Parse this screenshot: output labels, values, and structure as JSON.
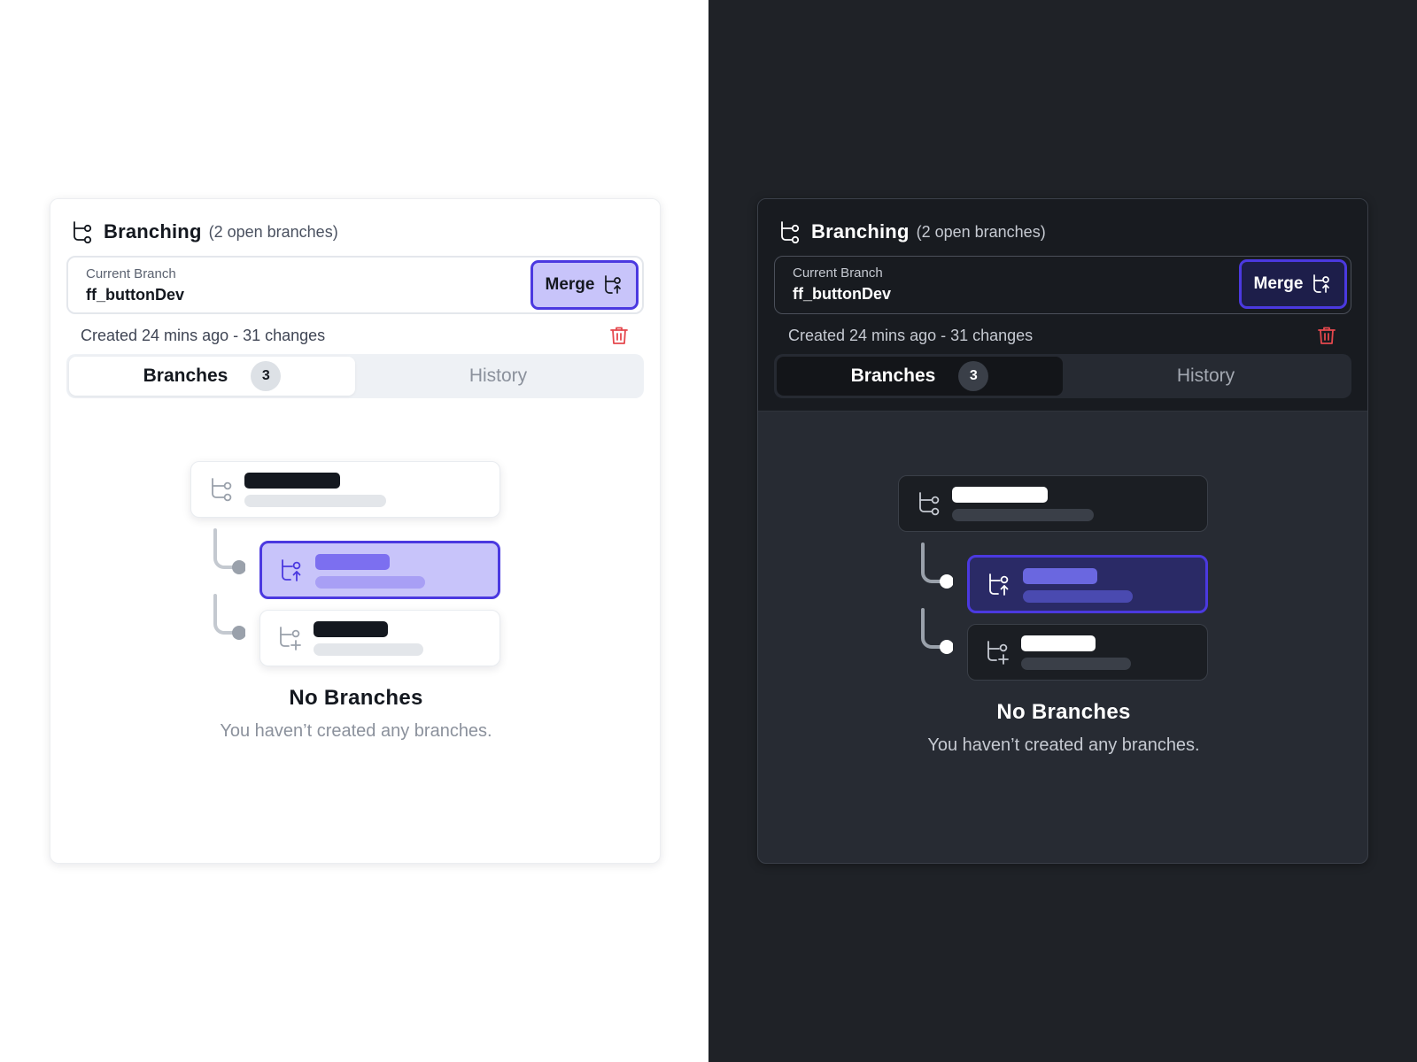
{
  "panels": [
    {
      "theme": "light",
      "header": {
        "title": "Branching",
        "subtitle": "(2 open branches)"
      },
      "current_branch": {
        "label": "Current Branch",
        "name": "ff_buttonDev",
        "merge_label": "Merge"
      },
      "meta": {
        "created_text": "Created 24 mins ago - 31 changes"
      },
      "tabs": [
        {
          "label": "Branches",
          "badge": "3",
          "active": true
        },
        {
          "label": "History",
          "active": false
        }
      ],
      "empty_state": {
        "title": "No Branches",
        "subtitle": "You haven’t created any branches."
      }
    },
    {
      "theme": "dark",
      "header": {
        "title": "Branching",
        "subtitle": "(2 open branches)"
      },
      "current_branch": {
        "label": "Current Branch",
        "name": "ff_buttonDev",
        "merge_label": "Merge"
      },
      "meta": {
        "created_text": "Created 24 mins ago - 31 changes"
      },
      "tabs": [
        {
          "label": "Branches",
          "badge": "3",
          "active": true
        },
        {
          "label": "History",
          "active": false
        }
      ],
      "empty_state": {
        "title": "No Branches",
        "subtitle": "You haven’t created any branches."
      }
    }
  ],
  "icons": {
    "header": "branch-icon",
    "merge_button": "merge-icon",
    "delete": "trash-icon",
    "illustration": [
      "branch-icon",
      "merge-icon",
      "add-branch-icon"
    ]
  },
  "colors": {
    "accent": "#4b39e0",
    "accent_light_fill": "#c8c4fa",
    "accent_dark_fill": "#1d1e4a",
    "danger": "#e5484d",
    "light_background": "#ffffff",
    "dark_background": "#1f2227"
  }
}
